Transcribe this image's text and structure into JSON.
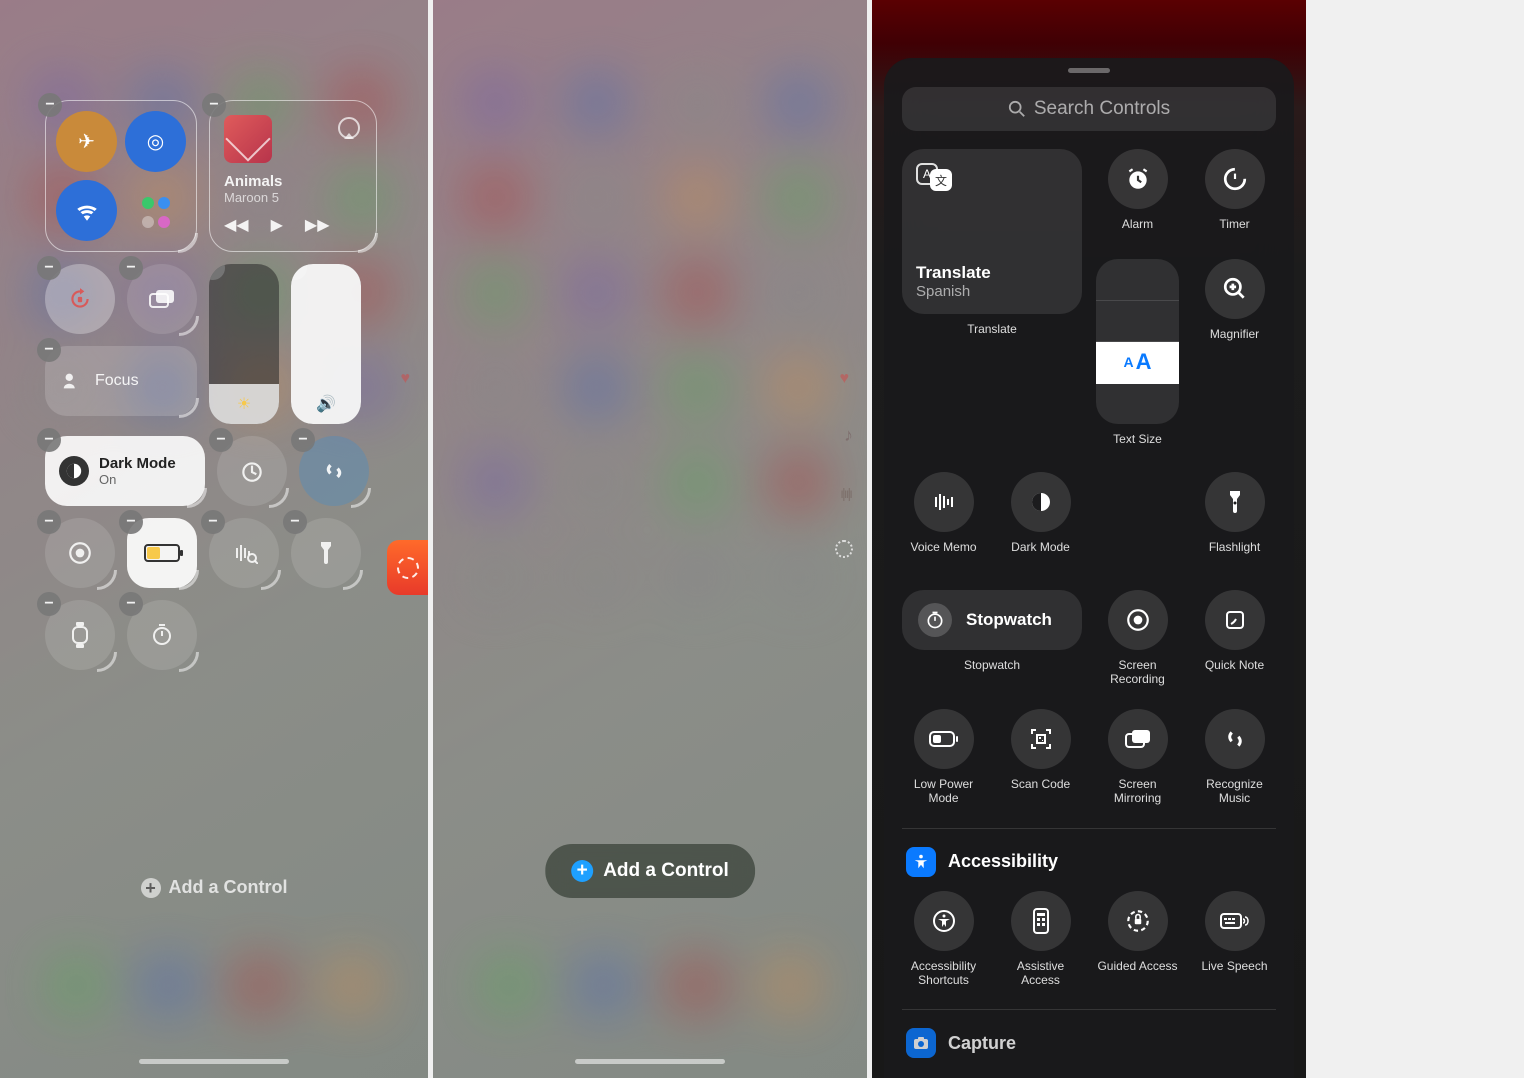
{
  "panel1": {
    "music": {
      "title": "Animals",
      "artist": "Maroon 5"
    },
    "focus": {
      "label": "Focus"
    },
    "dark_mode": {
      "title": "Dark Mode",
      "sub": "On"
    },
    "add_control": "Add a Control"
  },
  "panel2": {
    "add_control": "Add a Control"
  },
  "panel3": {
    "search_placeholder": "Search Controls",
    "translate": {
      "title": "Translate",
      "sub": "Spanish",
      "label": "Translate"
    },
    "items": {
      "alarm": "Alarm",
      "timer": "Timer",
      "magnifier": "Magnifier",
      "voice_memo": "Voice Memo",
      "dark_mode": "Dark Mode",
      "text_size": "Text Size",
      "flashlight": "Flashlight",
      "stopwatch_card": "Stopwatch",
      "stopwatch_lbl": "Stopwatch",
      "screen_recording": "Screen Recording",
      "quick_note": "Quick Note",
      "low_power": "Low Power Mode",
      "scan_code": "Scan Code",
      "screen_mirroring": "Screen Mirroring",
      "recognize_music": "Recognize Music",
      "acc_shortcuts": "Accessibility Shortcuts",
      "assistive_access": "Assistive Access",
      "guided_access": "Guided Access",
      "live_speech": "Live Speech"
    },
    "sections": {
      "accessibility": "Accessibility",
      "capture": "Capture"
    }
  }
}
